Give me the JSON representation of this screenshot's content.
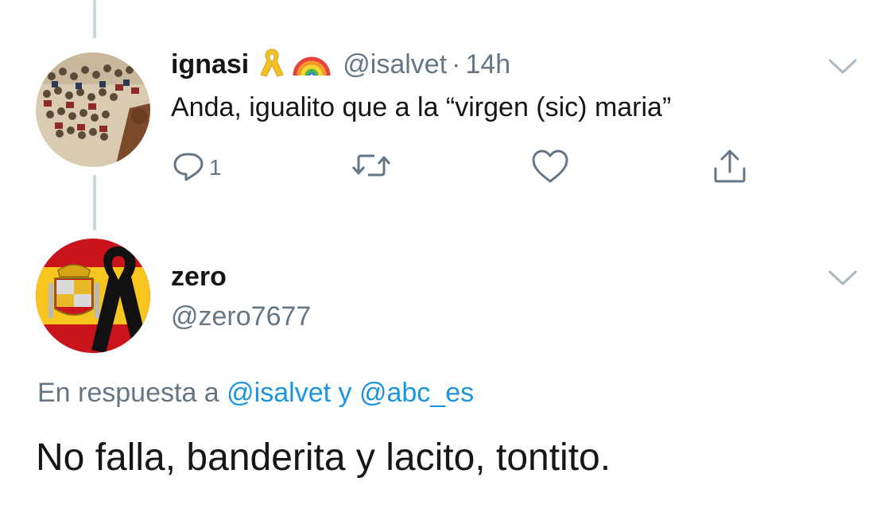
{
  "reply_tweet": {
    "display_name": "ignasi",
    "badges": [
      "yellow-ribbon-icon",
      "rainbow-icon"
    ],
    "handle": "@isalvet",
    "separator": "·",
    "timestamp": "14h",
    "text": "Anda, igualito que a la “virgen (sic) maria”",
    "actions": {
      "reply_count": "1",
      "retweet_count": "",
      "like_count": ""
    }
  },
  "main_tweet": {
    "display_name": "zero",
    "handle": "@zero7677",
    "reply_context": {
      "prefix": "En respuesta a",
      "mention_1": "@isalvet",
      "connector": "y",
      "mention_2": "@abc_es"
    },
    "text": "No falla, banderita y lacito, tontito."
  },
  "colors": {
    "text_primary": "#14171a",
    "text_secondary": "#657786",
    "link": "#1b95e0",
    "thread_line": "#ccd6dd",
    "chevron": "#aab8c2"
  }
}
